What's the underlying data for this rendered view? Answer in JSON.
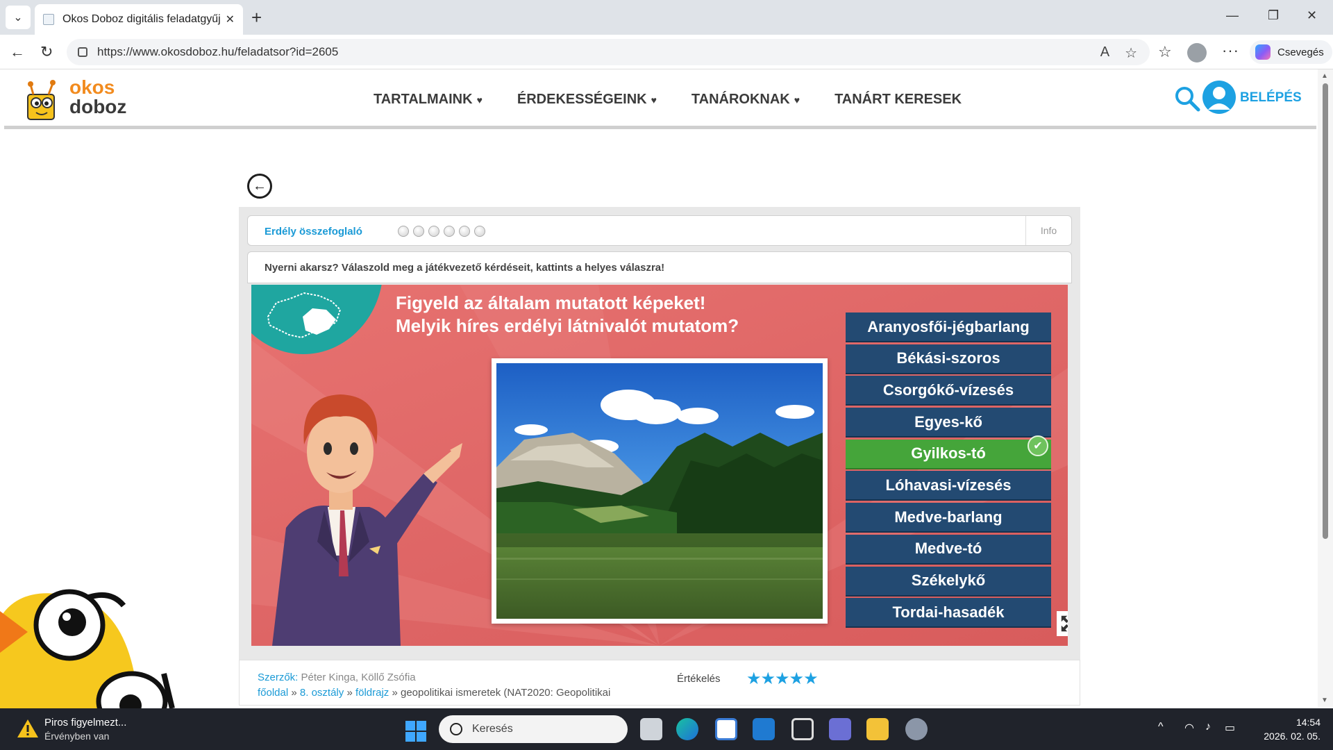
{
  "browser": {
    "tab_title": "Okos Doboz digitális feladatgyűjte",
    "url": "https://www.okosdoboz.hu/feladatsor?id=2605",
    "copilot_label": "Csevegés"
  },
  "site": {
    "logo_top": "okos",
    "logo_bottom": "doboz",
    "nav": [
      {
        "label": "TARTALMAINK",
        "caret": "♥"
      },
      {
        "label": "ÉRDEKESSÉGEINK",
        "caret": "♥"
      },
      {
        "label": "TANÁROKNAK",
        "caret": "♥"
      },
      {
        "label": "TANÁRT KERESEK",
        "caret": ""
      }
    ],
    "login_label": "BELÉPÉS"
  },
  "quiz": {
    "title": "Erdély összefoglaló",
    "info_label": "Info",
    "instruction": "Nyerni akarsz? Válaszold meg a játékvezető kérdéseit, kattints a helyes válaszra!",
    "question_line1": "Figyeld az általam mutatott képeket!",
    "question_line2": "Melyik híres erdélyi látnivalót mutatom?",
    "answers": [
      "Aranyosfői-jégbarlang",
      "Békási-szoros",
      "Csorgókő-vízesés",
      "Egyes-kő",
      "Gyilkos-tó",
      "Lóhavasi-vízesés",
      "Medve-barlang",
      "Medve-tó",
      "Székelykő",
      "Tordai-hasadék"
    ],
    "correct_answer": "Gyilkos-tó",
    "colors": {
      "answer_bg": "#234a72",
      "correct_bg": "#45a53a",
      "stage_bg": "#de6565",
      "badge": "#1fa6a0"
    }
  },
  "meta": {
    "authors_label": "Szerzők:",
    "authors": "Péter Kinga, Köllő Zsófia",
    "crumb_home": "főoldal",
    "crumb_sep": "»",
    "crumb_class": "8. osztály",
    "crumb_subject": "földrajz",
    "crumb_topic": "» geopolitikai ismeretek (NAT2020: Geopolitikai",
    "rating_label": "Értékelés",
    "stars": "★★★★★"
  },
  "taskbar": {
    "alert_title": "Piros figyelmezt...",
    "alert_subtitle": "Érvényben van",
    "search_placeholder": "Keresés",
    "time": "14:54",
    "date": "2026. 02. 05."
  }
}
